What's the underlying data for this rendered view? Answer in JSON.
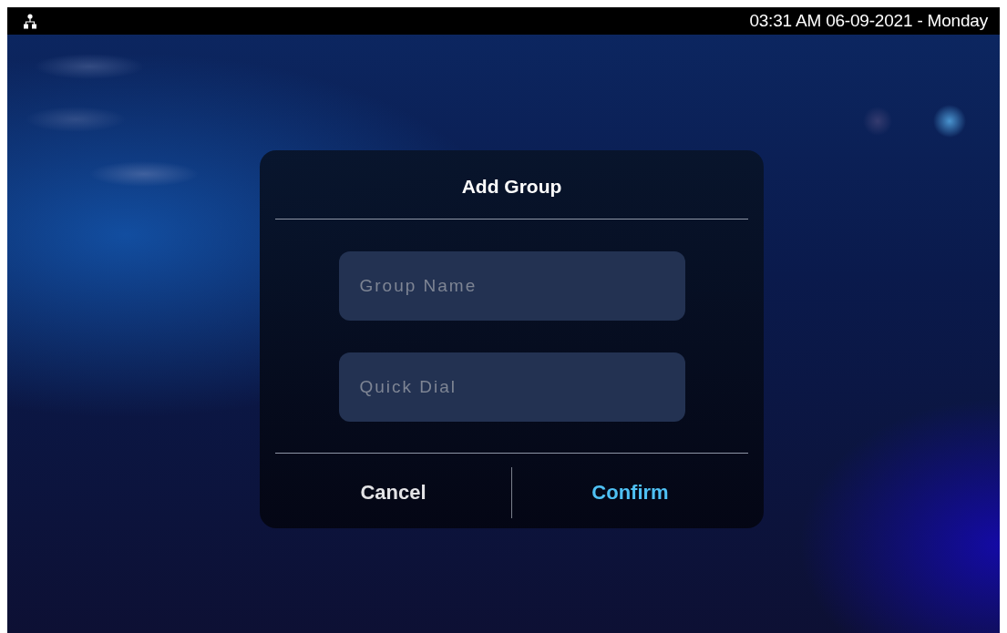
{
  "status_bar": {
    "datetime": "03:31 AM  06-09-2021 - Monday"
  },
  "dialog": {
    "title": "Add Group",
    "fields": [
      {
        "placeholder": "Group Name"
      },
      {
        "placeholder": "Quick Dial"
      }
    ],
    "buttons": [
      {
        "label": "Cancel",
        "kind": "secondary"
      },
      {
        "label": "Confirm",
        "kind": "primary"
      }
    ]
  }
}
